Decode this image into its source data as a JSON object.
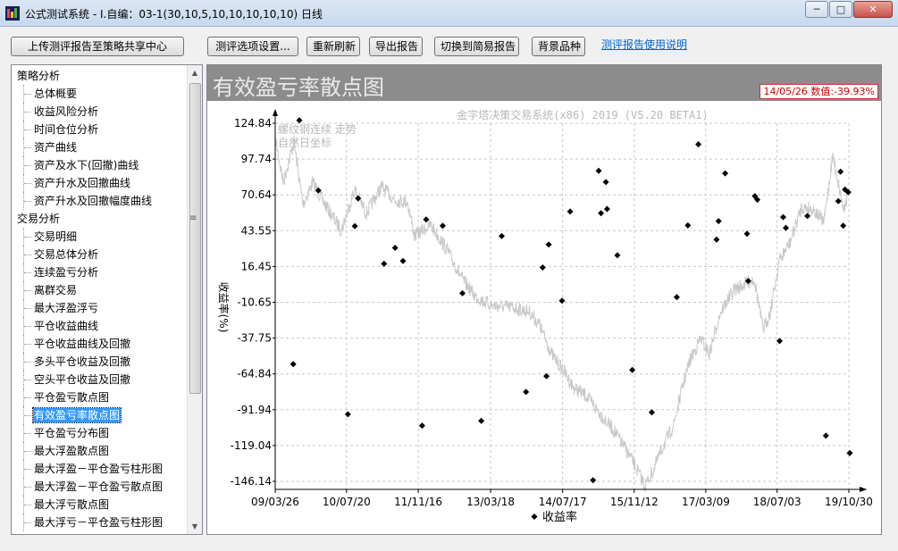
{
  "window": {
    "title": "公式测试系统 - I.自编：03-1(30,10,5,10,10,10,10,10) 日线",
    "minimize": "─",
    "maximize": "□",
    "close": "✕"
  },
  "toolbar": {
    "upload": "上传测评报告至策略共享中心",
    "options": "测评选项设置...",
    "refresh": "重新刷新",
    "export": "导出报告",
    "switch": "切换到简易报告",
    "background": "背景品种",
    "help_link": "测评报告使用说明"
  },
  "sidebar": {
    "groups": [
      {
        "label": "策略分析",
        "items": [
          "总体概要",
          "收益风险分析",
          "时间仓位分析",
          "资产曲线",
          "资产及水下(回撤)曲线",
          "资产升水及回撤曲线",
          "资产升水及回撤幅度曲线"
        ]
      },
      {
        "label": "交易分析",
        "items": [
          "交易明细",
          "交易总体分析",
          "连续盈亏分析",
          "离群交易",
          "最大浮盈浮亏",
          "平仓收益曲线",
          "平仓收益曲线及回撤",
          "多头平仓收益及回撤",
          "空头平仓收益及回撤",
          "平仓盈亏散点图",
          "有效盈亏率散点图",
          "平仓盈亏分布图",
          "最大浮盈散点图",
          "最大浮盈－平仓盈亏柱形图",
          "最大浮盈－平仓盈亏散点图",
          "最大浮亏散点图",
          "最大浮亏－平仓盈亏柱形图"
        ]
      }
    ],
    "selected": "有效盈亏率散点图"
  },
  "panel": {
    "title": "有效盈亏率散点图",
    "readout": "14/05/26 数值:-39.93%"
  },
  "chart_data": {
    "type": "scatter",
    "title": "金字塔决策交易系统(x86) 2019 (V5.20 BETA1)",
    "background_label_1": "螺纹钢连续 走势",
    "background_label_2": "自然日坐标",
    "ylabel": "收益率(%)",
    "legend": "收益率",
    "legend_position": "bottom",
    "grid": true,
    "ylim": [
      -160,
      135
    ],
    "y_ticks": [
      124.84,
      97.74,
      70.64,
      43.55,
      16.45,
      -10.65,
      -37.75,
      -64.84,
      -91.94,
      -119.04,
      -146.14
    ],
    "x_ticks": [
      "09/03/26",
      "10/07/20",
      "11/11/16",
      "13/03/18",
      "14/07/17",
      "15/11/12",
      "17/03/09",
      "18/07/03",
      "19/10/30"
    ],
    "x_range": [
      "2009-03-26",
      "2019-10-30"
    ],
    "points": [
      [
        "2009-07-26",
        -57.5
      ],
      [
        "2009-09-05",
        127.0
      ],
      [
        "2010-01-11",
        74.0
      ],
      [
        "2010-07-29",
        -95.4
      ],
      [
        "2010-09-14",
        47.0
      ],
      [
        "2010-10-06",
        68.0
      ],
      [
        "2011-03-30",
        18.5
      ],
      [
        "2011-06-13",
        30.6
      ],
      [
        "2011-08-05",
        20.6
      ],
      [
        "2011-12-12",
        -104.0
      ],
      [
        "2012-01-08",
        52.0
      ],
      [
        "2012-04-29",
        47.2
      ],
      [
        "2012-09-09",
        -3.8
      ],
      [
        "2013-01-14",
        -100.3
      ],
      [
        "2013-06-01",
        39.4
      ],
      [
        "2013-11-12",
        -78.5
      ],
      [
        "2014-03-04",
        15.7
      ],
      [
        "2014-04-14",
        33.0
      ],
      [
        "2014-07-13",
        -9.5
      ],
      [
        "2014-03-30",
        -66.6
      ],
      [
        "2014-09-06",
        58.0
      ],
      [
        "2015-02-07",
        -145.3
      ],
      [
        "2015-03-17",
        88.9
      ],
      [
        "2015-04-02",
        56.8
      ],
      [
        "2015-05-05",
        80.3
      ],
      [
        "2015-05-13",
        60.0
      ],
      [
        "2015-07-21",
        24.9
      ],
      [
        "2015-10-30",
        -61.9
      ],
      [
        "2016-03-09",
        -93.9
      ],
      [
        "2016-08-25",
        -6.8
      ],
      [
        "2016-11-08",
        47.5
      ],
      [
        "2017-01-18",
        108.9
      ],
      [
        "2017-05-20",
        36.8
      ],
      [
        "2017-06-03",
        50.8
      ],
      [
        "2017-07-18",
        86.9
      ],
      [
        "2017-12-12",
        41.2
      ],
      [
        "2017-12-20",
        5.5
      ],
      [
        "2018-02-03",
        69.7
      ],
      [
        "2018-02-20",
        67.0
      ],
      [
        "2018-07-20",
        -40.0
      ],
      [
        "2018-08-13",
        53.8
      ],
      [
        "2018-08-31",
        45.7
      ],
      [
        "2019-01-23",
        54.6
      ],
      [
        "2019-05-28",
        -111.6
      ],
      [
        "2019-08-20",
        65.9
      ],
      [
        "2019-09-04",
        88.2
      ],
      [
        "2019-09-22",
        47.3
      ],
      [
        "2019-10-04",
        74.6
      ],
      [
        "2019-10-26",
        72.7
      ],
      [
        "2019-11-05",
        -124.8
      ]
    ]
  }
}
